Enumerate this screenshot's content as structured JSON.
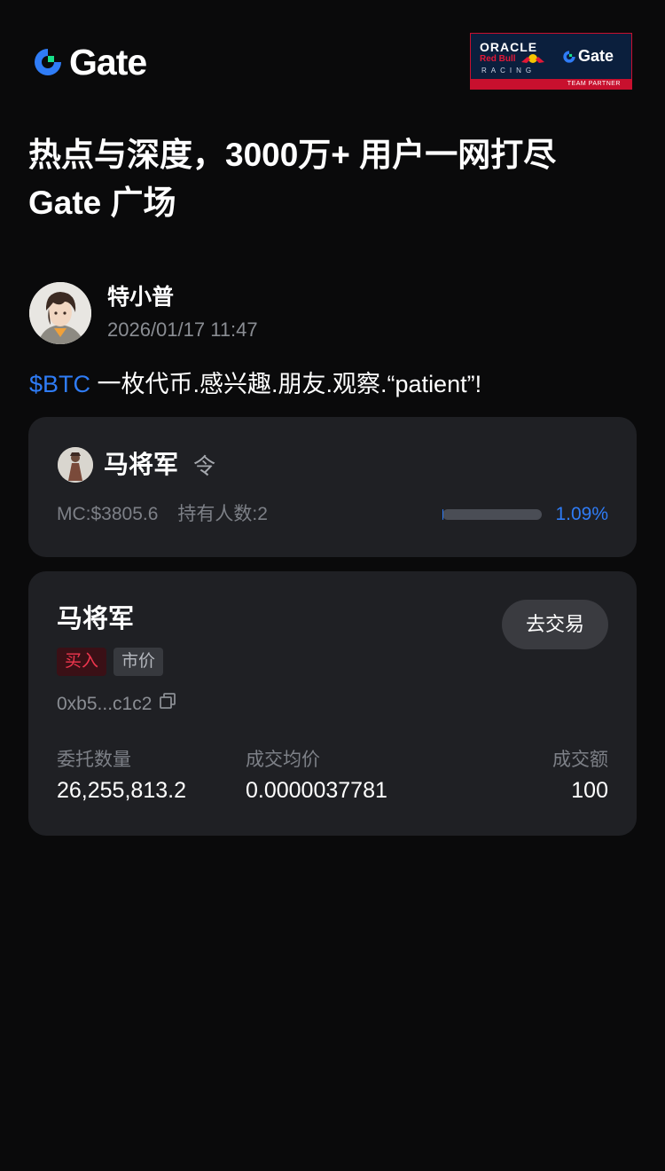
{
  "brand": {
    "name": "Gate",
    "accent": "#2f7cf6",
    "green": "#17e08a"
  },
  "partner_badge": {
    "line1": "ORACLE",
    "line2": "Red Bull",
    "line3": "RACING",
    "brand": "Gate",
    "strip": "TEAM PARTNER"
  },
  "headline": {
    "line1": "热点与深度，3000万+ 用户一网打尽",
    "line2": "Gate 广场"
  },
  "post": {
    "author": "特小普",
    "timestamp": "2026/01/17 11:47",
    "ticker": "$BTC",
    "text": " 一枚代币.感兴趣.朋友.观察.“patient”!"
  },
  "token_card": {
    "name": "马将军",
    "symbol": "令",
    "market_cap": "MC:$3805.6",
    "holders": "持有人数:2",
    "progress_percent": 1.09,
    "progress_label": "1.09%"
  },
  "trade_card": {
    "name": "马将军",
    "button_label": "去交易",
    "tag_buy": "买入",
    "tag_market": "市价",
    "address": "0xb5...c1c2",
    "columns": [
      {
        "label": "委托数量",
        "value": "26,255,813.2"
      },
      {
        "label": "成交均价",
        "value": "0.0000037781"
      },
      {
        "label": "成交额",
        "value": "100"
      }
    ]
  },
  "icons": [
    "gate-logo-icon",
    "copy-icon",
    "avatar",
    "token-icon",
    "red-bull-icon"
  ]
}
